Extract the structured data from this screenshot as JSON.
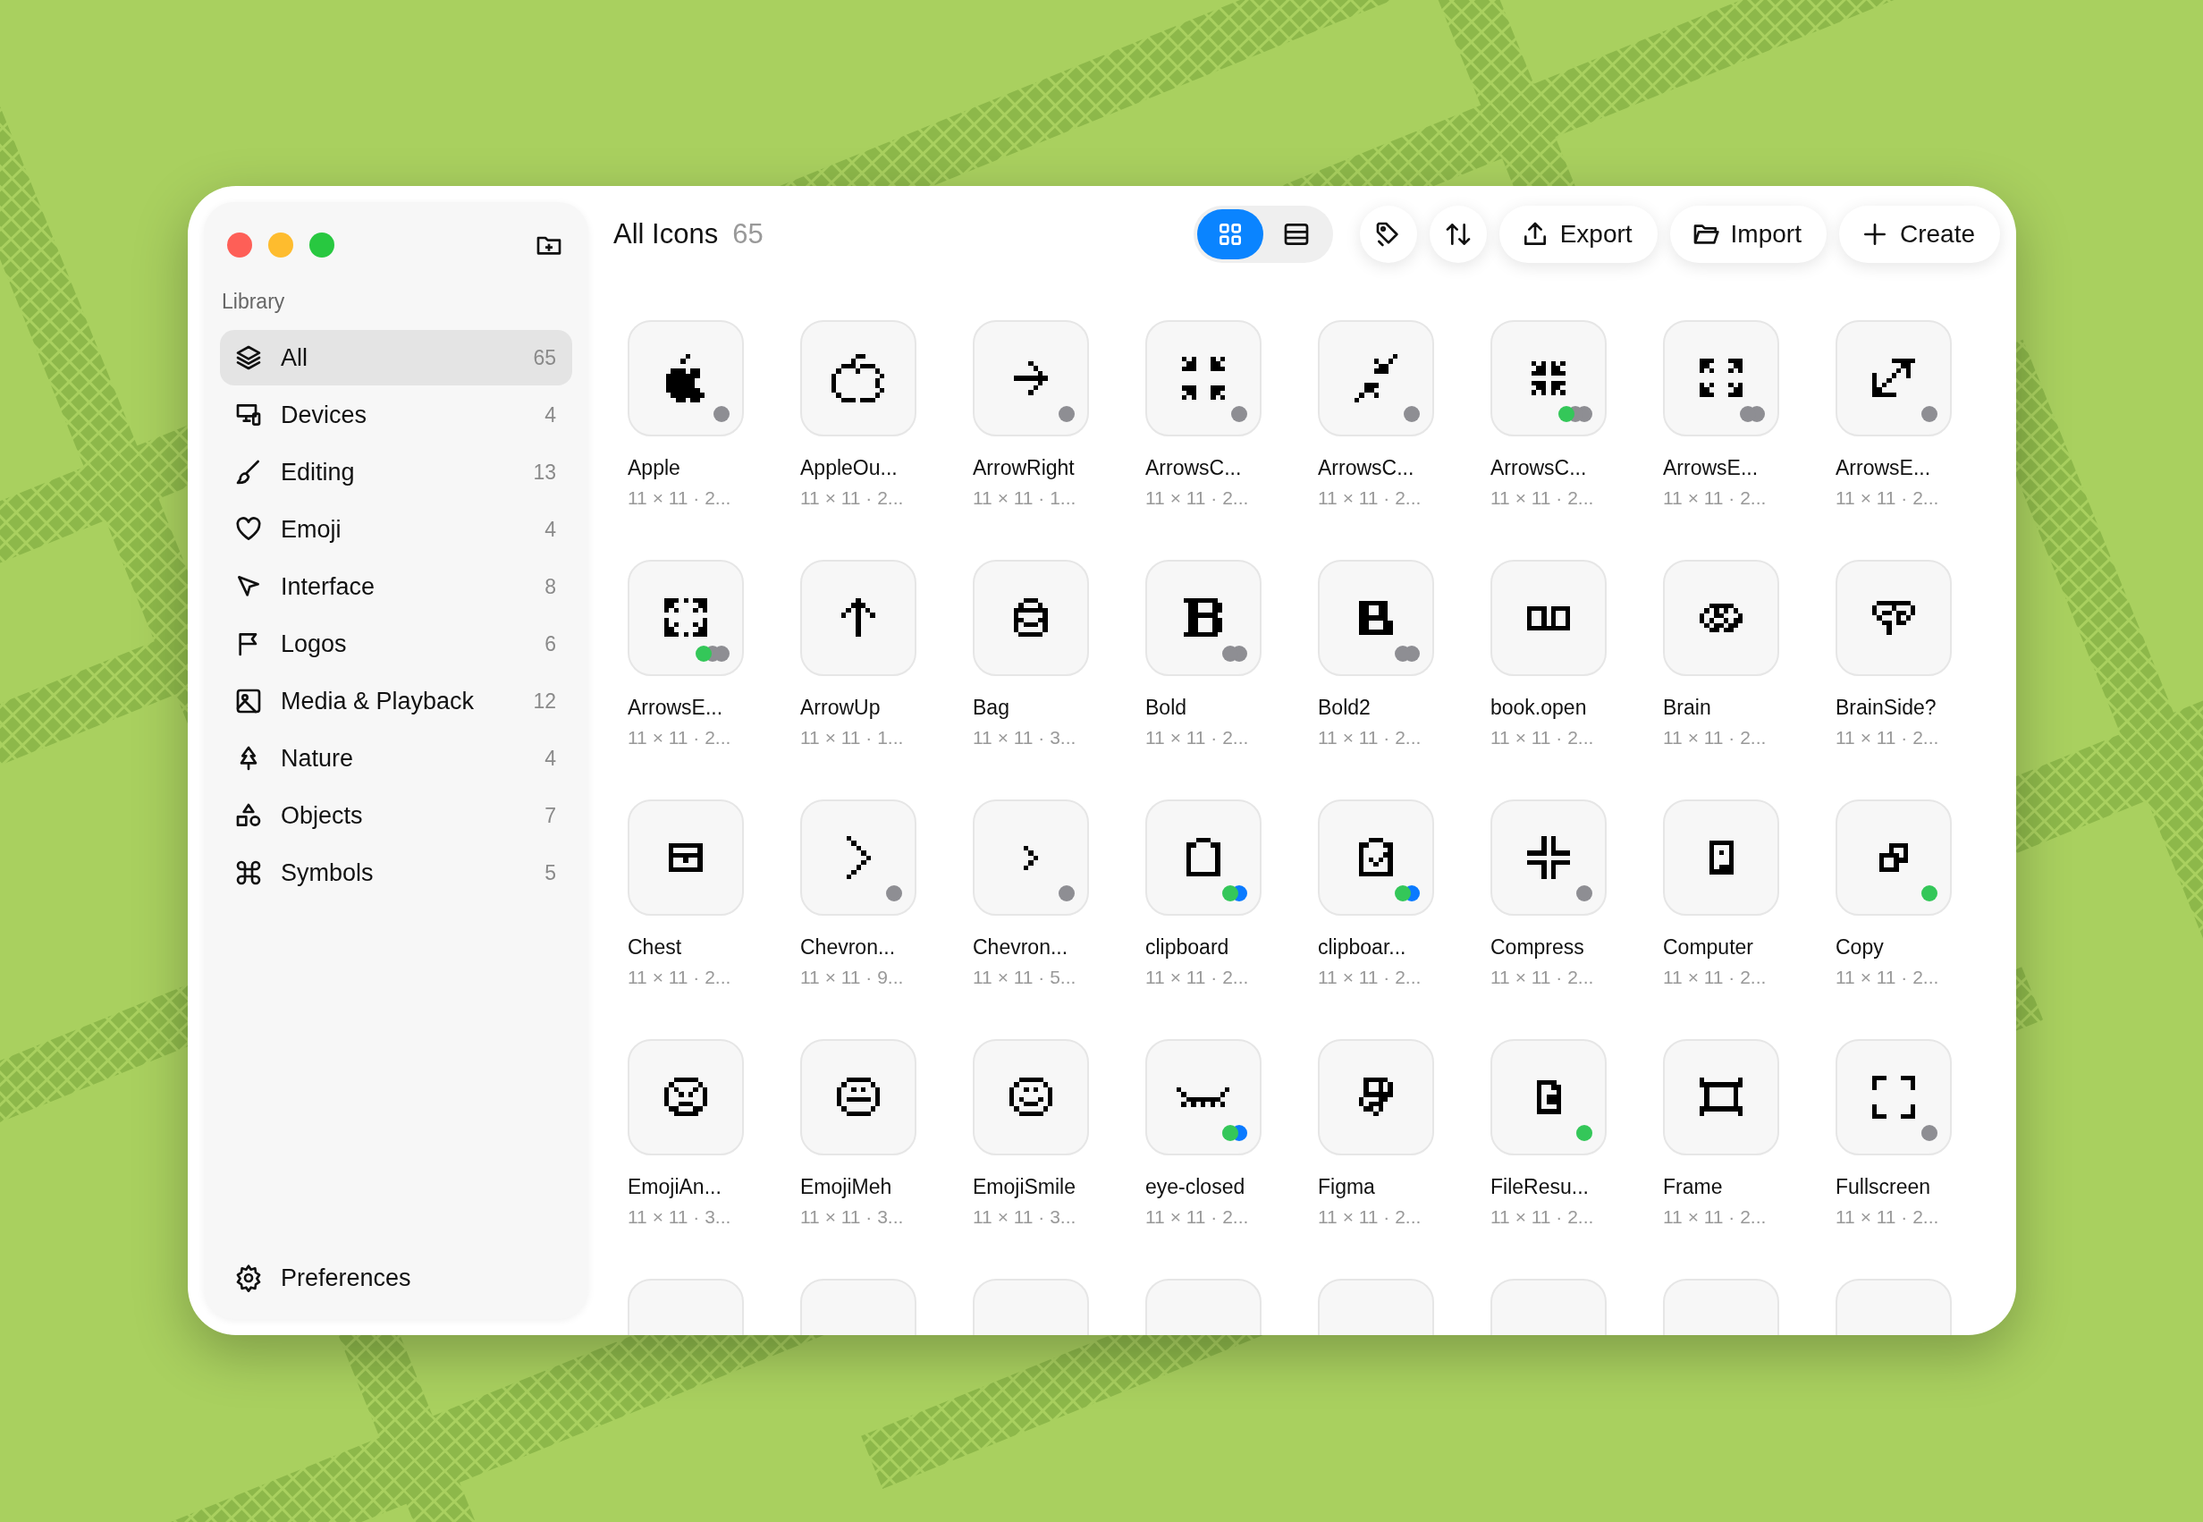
{
  "sidebar": {
    "section_title": "Library",
    "items": [
      {
        "kind": "layers",
        "label": "All",
        "count": "65",
        "selected": true
      },
      {
        "kind": "devices",
        "label": "Devices",
        "count": "4",
        "selected": false
      },
      {
        "kind": "brush",
        "label": "Editing",
        "count": "13",
        "selected": false
      },
      {
        "kind": "heart",
        "label": "Emoji",
        "count": "4",
        "selected": false
      },
      {
        "kind": "cursor",
        "label": "Interface",
        "count": "8",
        "selected": false
      },
      {
        "kind": "flag",
        "label": "Logos",
        "count": "6",
        "selected": false
      },
      {
        "kind": "image",
        "label": "Media & Playback",
        "count": "12",
        "selected": false
      },
      {
        "kind": "tree",
        "label": "Nature",
        "count": "4",
        "selected": false
      },
      {
        "kind": "shapes",
        "label": "Objects",
        "count": "7",
        "selected": false
      },
      {
        "kind": "command",
        "label": "Symbols",
        "count": "5",
        "selected": false
      }
    ],
    "footer": {
      "label": "Preferences"
    }
  },
  "header": {
    "title": "All Icons",
    "count": "65",
    "view_toggle": [
      {
        "kind": "grid",
        "selected": true
      },
      {
        "kind": "list",
        "selected": false
      }
    ],
    "buttons": [
      {
        "kind": "tag"
      },
      {
        "kind": "sort"
      },
      {
        "kind": "export",
        "label": "Export"
      },
      {
        "kind": "import",
        "label": "Import"
      },
      {
        "kind": "create",
        "label": "Create"
      }
    ]
  },
  "icons": [
    {
      "kind": "icon",
      "name": "Apple",
      "meta": "11 × 11 · 2...",
      "tags": [
        {
          "color": "#8e8e93"
        }
      ]
    },
    {
      "kind": "icon",
      "name": "AppleOu...",
      "meta": "11 × 11 · 2..."
    },
    {
      "kind": "icon",
      "name": "ArrowRight",
      "meta": "11 × 11 · 1...",
      "tags": [
        {
          "color": "#8e8e93"
        }
      ]
    },
    {
      "kind": "icon",
      "name": "ArrowsC...",
      "meta": "11 × 11 · 2...",
      "tags": [
        {
          "color": "#8e8e93"
        }
      ]
    },
    {
      "kind": "icon",
      "name": "ArrowsC...",
      "meta": "11 × 11 · 2...",
      "tags": [
        {
          "color": "#8e8e93"
        }
      ]
    },
    {
      "kind": "icon",
      "name": "ArrowsC...",
      "meta": "11 × 11 · 2...",
      "tags": [
        {
          "color": "#34c759"
        },
        {
          "color": "#8e8e93"
        },
        {
          "color": "#8e8e93"
        }
      ]
    },
    {
      "kind": "icon",
      "name": "ArrowsE...",
      "meta": "11 × 11 · 2...",
      "tags": [
        {
          "color": "#8e8e93"
        },
        {
          "color": "#8e8e93"
        }
      ]
    },
    {
      "kind": "icon",
      "name": "ArrowsE...",
      "meta": "11 × 11 · 2...",
      "tags": [
        {
          "color": "#8e8e93"
        }
      ]
    },
    {
      "kind": "icon",
      "name": "ArrowsE...",
      "meta": "11 × 11 · 2...",
      "tags": [
        {
          "color": "#34c759"
        },
        {
          "color": "#8e8e93"
        },
        {
          "color": "#8e8e93"
        }
      ]
    },
    {
      "kind": "icon",
      "name": "ArrowUp",
      "meta": "11 × 11 · 1..."
    },
    {
      "kind": "icon",
      "name": "Bag",
      "meta": "11 × 11 · 3..."
    },
    {
      "kind": "icon",
      "name": "Bold",
      "meta": "11 × 11 · 2...",
      "tags": [
        {
          "color": "#8e8e93"
        },
        {
          "color": "#8e8e93"
        }
      ]
    },
    {
      "kind": "icon",
      "name": "Bold2",
      "meta": "11 × 11 · 2...",
      "tags": [
        {
          "color": "#8e8e93"
        },
        {
          "color": "#8e8e93"
        }
      ]
    },
    {
      "kind": "icon",
      "name": "book.open",
      "meta": "11 × 11 · 2..."
    },
    {
      "kind": "icon",
      "name": "Brain",
      "meta": "11 × 11 · 2..."
    },
    {
      "kind": "icon",
      "name": "BrainSide?",
      "meta": "11 × 11 · 2..."
    },
    {
      "kind": "icon",
      "name": "Chest",
      "meta": "11 × 11 · 2..."
    },
    {
      "kind": "icon",
      "name": "Chevron...",
      "meta": "11 × 11 · 9...",
      "tags": [
        {
          "color": "#8e8e93"
        }
      ]
    },
    {
      "kind": "icon",
      "name": "Chevron...",
      "meta": "11 × 11 · 5...",
      "tags": [
        {
          "color": "#8e8e93"
        }
      ]
    },
    {
      "kind": "icon",
      "name": "clipboard",
      "meta": "11 × 11 · 2...",
      "tags": [
        {
          "color": "#34c759"
        },
        {
          "color": "#0a7aff"
        }
      ]
    },
    {
      "kind": "icon",
      "name": "clipboar...",
      "meta": "11 × 11 · 2...",
      "tags": [
        {
          "color": "#34c759"
        },
        {
          "color": "#0a7aff"
        }
      ]
    },
    {
      "kind": "icon",
      "name": "Compress",
      "meta": "11 × 11 · 2...",
      "tags": [
        {
          "color": "#8e8e93"
        }
      ]
    },
    {
      "kind": "icon",
      "name": "Computer",
      "meta": "11 × 11 · 2..."
    },
    {
      "kind": "icon",
      "name": "Copy",
      "meta": "11 × 11 · 2...",
      "tags": [
        {
          "color": "#34c759"
        }
      ]
    },
    {
      "kind": "icon",
      "name": "EmojiAn...",
      "meta": "11 × 11 · 3..."
    },
    {
      "kind": "icon",
      "name": "EmojiMeh",
      "meta": "11 × 11 · 3..."
    },
    {
      "kind": "icon",
      "name": "EmojiSmile",
      "meta": "11 × 11 · 3..."
    },
    {
      "kind": "icon",
      "name": "eye-closed",
      "meta": "11 × 11 · 2...",
      "tags": [
        {
          "color": "#34c759"
        },
        {
          "color": "#0a7aff"
        }
      ]
    },
    {
      "kind": "icon",
      "name": "Figma",
      "meta": "11 × 11 · 2..."
    },
    {
      "kind": "icon",
      "name": "FileResu...",
      "meta": "11 × 11 · 2...",
      "tags": [
        {
          "color": "#34c759"
        }
      ]
    },
    {
      "kind": "icon",
      "name": "Frame",
      "meta": "11 × 11 · 2..."
    },
    {
      "kind": "icon",
      "name": "Fullscreen",
      "meta": "11 × 11 · 2...",
      "tags": [
        {
          "color": "#8e8e93"
        }
      ]
    },
    {
      "kind": "cut"
    },
    {
      "kind": "cut"
    },
    {
      "kind": "cut"
    },
    {
      "kind": "cut"
    },
    {
      "kind": "cut"
    },
    {
      "kind": "cut"
    },
    {
      "kind": "cut"
    },
    {
      "kind": "cut"
    }
  ]
}
